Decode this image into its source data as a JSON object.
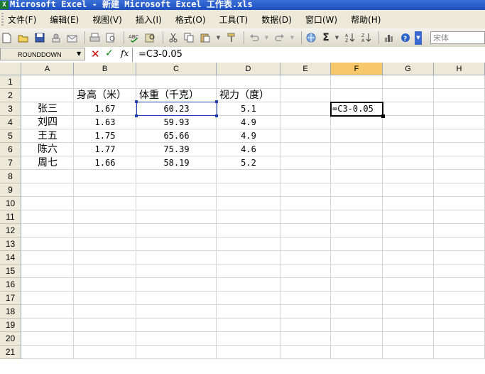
{
  "window": {
    "title": "Microsoft Excel - 新建 Microsoft Excel 工作表.xls",
    "app_icon": "excel-icon"
  },
  "menu": {
    "items": [
      "文件(F)",
      "编辑(E)",
      "视图(V)",
      "插入(I)",
      "格式(O)",
      "工具(T)",
      "数据(D)",
      "窗口(W)",
      "帮助(H)"
    ]
  },
  "toolbar": {
    "icons": [
      "new-icon",
      "open-icon",
      "save-icon",
      "permission-icon",
      "email-icon",
      "print-icon",
      "print-preview-icon",
      "spelling-icon",
      "research-icon",
      "cut-icon",
      "copy-icon",
      "paste-icon",
      "format-painter-icon",
      "undo-icon",
      "redo-icon",
      "hyperlink-icon",
      "autosum-icon",
      "sort-ascending-icon",
      "sort-descending-icon",
      "chart-icon",
      "help-icon"
    ],
    "autosum_label": "Σ",
    "font_name": "宋体"
  },
  "formula_bar": {
    "name_box": "ROUNDDOWN",
    "fx_label": "fx",
    "formula": "=C3-0.05"
  },
  "sheet": {
    "columns": [
      "A",
      "B",
      "C",
      "D",
      "E",
      "F",
      "G",
      "H"
    ],
    "selected_column": "F",
    "rows": [
      "1",
      "2",
      "3",
      "4",
      "5",
      "6",
      "7",
      "8",
      "9",
      "10",
      "11",
      "12",
      "13",
      "14",
      "15",
      "16",
      "17",
      "18",
      "19",
      "20",
      "21"
    ],
    "headers": {
      "height": "身高（米）",
      "weight": "体重（千克）",
      "vision": "视力（度）"
    },
    "records": [
      {
        "name": "张三",
        "height": "1.67",
        "weight": "60.23",
        "vision": "5.1"
      },
      {
        "name": "刘四",
        "height": "1.63",
        "weight": "59.93",
        "vision": "4.9"
      },
      {
        "name": "王五",
        "height": "1.75",
        "weight": "65.66",
        "vision": "4.9"
      },
      {
        "name": "陈六",
        "height": "1.77",
        "weight": "75.39",
        "vision": "4.6"
      },
      {
        "name": "周七",
        "height": "1.66",
        "weight": "58.19",
        "vision": "5.2"
      }
    ],
    "edit_cell": {
      "ref": "F3",
      "text": "=C3-0.05"
    }
  },
  "colors": {
    "title_bar": "#2457c5",
    "selected_header": "#f7c86a",
    "reference_border": "#1f3fb0",
    "gridline": "#d4d4d4"
  }
}
